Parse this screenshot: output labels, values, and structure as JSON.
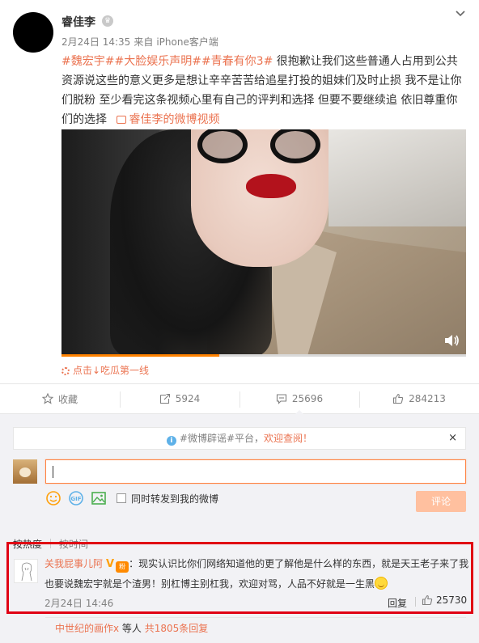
{
  "post": {
    "username": "睿佳李",
    "date": "2月24日 14:35",
    "source_prefix": "来自",
    "source": "iPhone客户端",
    "tags": [
      "#魏宏宇#",
      "#大脸娱乐声明#",
      "#青春有你3#"
    ],
    "body": "很抱歉让我们这些普通人占用到公共资源说这些的意义更多是想让辛辛苦苦给追星打投的姐妹们及时止损 我不是让你们脱粉 至少看完这条视频心里有自己的评判和选择 但要不要继续追 依旧尊重你们的选择",
    "video_link": "睿佳李的微博视频",
    "video_progress": 0.39,
    "video_source": "点击↓吃瓜第一线"
  },
  "actions": {
    "favorite": "收藏",
    "forward": "5924",
    "comment": "25696",
    "like": "284213"
  },
  "notice": {
    "text": "#微博辟谣#平台，",
    "link": "欢迎查阅！",
    "close": "×"
  },
  "composer": {
    "sync_label": "同时转发到我的微博",
    "submit": "评论"
  },
  "sort": {
    "hot": "按热度",
    "time": "按时间"
  },
  "top_comment": {
    "user": "关我屁事儿阿",
    "badge": "V",
    "text": "：现实认识比你们网络知道他的更了解他是什么样的东西，就是天王老子来了我也要说魏宏宇就是个渣男！别杠博主别杠我，欢迎对骂，人品不好就是一生黑",
    "time": "2月24日 14:46",
    "reply": "回复",
    "likes": "25730"
  },
  "sub_reply": {
    "user": "中世纪的画作x",
    "middle": " 等人 ",
    "count": "共1805条回复"
  }
}
